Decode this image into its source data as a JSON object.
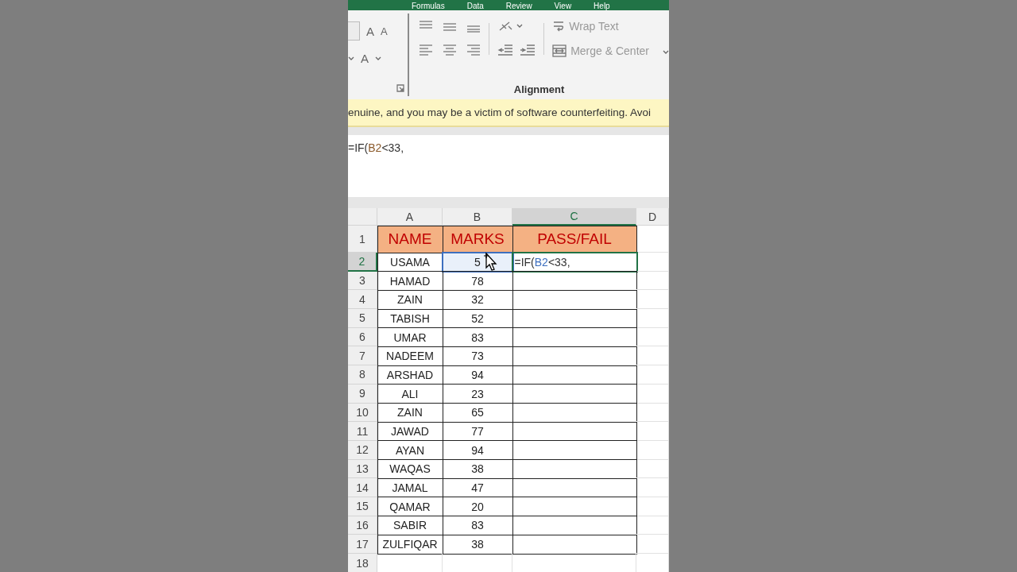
{
  "ribbon": {
    "tabs": [
      "Formulas",
      "Data",
      "Review",
      "View",
      "Help"
    ],
    "font_buttons": [
      "A",
      "A",
      "A"
    ],
    "wrap_text": "Wrap Text",
    "merge_center": "Merge & Center",
    "group_label": "Alignment"
  },
  "warning": "enuine, and you may be a victim of software counterfeiting. Avoi",
  "formula_bar": {
    "parts": [
      {
        "text": "=IF(",
        "kind": "plain"
      },
      {
        "text": "B2",
        "kind": "reference"
      },
      {
        "text": "<33,",
        "kind": "plain"
      }
    ]
  },
  "sheet": {
    "columns": [
      {
        "label": "A",
        "selected": false
      },
      {
        "label": "B",
        "selected": false
      },
      {
        "label": "C",
        "selected": true
      },
      {
        "label": "D",
        "selected": false
      }
    ],
    "header": {
      "number": "1",
      "cells": [
        "NAME",
        "MARKS",
        "PASS/FAIL"
      ]
    },
    "rows": [
      {
        "number": "2",
        "name": "USAMA",
        "marks": "5",
        "selected": true,
        "formula": [
          {
            "text": "=IF(",
            "kind": "plain"
          },
          {
            "text": "B2",
            "kind": "reference"
          },
          {
            "text": "<33,",
            "kind": "plain"
          }
        ]
      },
      {
        "number": "3",
        "name": "HAMAD",
        "marks": "78",
        "selected": false
      },
      {
        "number": "4",
        "name": "ZAIN",
        "marks": "32",
        "selected": false
      },
      {
        "number": "5",
        "name": "TABISH",
        "marks": "52",
        "selected": false
      },
      {
        "number": "6",
        "name": "UMAR",
        "marks": "83",
        "selected": false
      },
      {
        "number": "7",
        "name": "NADEEM",
        "marks": "73",
        "selected": false
      },
      {
        "number": "8",
        "name": "ARSHAD",
        "marks": "94",
        "selected": false
      },
      {
        "number": "9",
        "name": "ALI",
        "marks": "23",
        "selected": false
      },
      {
        "number": "10",
        "name": "ZAIN",
        "marks": "65",
        "selected": false
      },
      {
        "number": "11",
        "name": "JAWAD",
        "marks": "77",
        "selected": false
      },
      {
        "number": "12",
        "name": "AYAN",
        "marks": "94",
        "selected": false
      },
      {
        "number": "13",
        "name": "WAQAS",
        "marks": "38",
        "selected": false
      },
      {
        "number": "14",
        "name": "JAMAL",
        "marks": "47",
        "selected": false
      },
      {
        "number": "15",
        "name": "QAMAR",
        "marks": "20",
        "selected": false
      },
      {
        "number": "16",
        "name": "SABIR",
        "marks": "83",
        "selected": false
      },
      {
        "number": "17",
        "name": "ZULFIQAR",
        "marks": "38",
        "selected": false
      }
    ],
    "empty_rows": [
      "18"
    ]
  }
}
